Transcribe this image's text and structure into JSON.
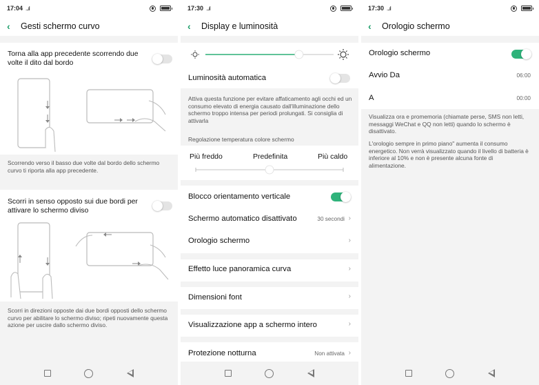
{
  "colors": {
    "accent": "#2fb37b",
    "back_arrow": "#1e9e6a",
    "background": "#f3f3f3"
  },
  "screen1": {
    "status": {
      "time": "17:04",
      "signal": "...ıl"
    },
    "header": {
      "back_icon": "chevron-left-icon",
      "title": "Gesti schermo curvo"
    },
    "gesture1": {
      "label": "Torna alla app precedente scorrendo due volte il dito dal bordo",
      "enabled": false,
      "description": "Scorrendo verso il basso due volte dal bordo dello schermo curvo ti riporta alla app precedente."
    },
    "gesture2": {
      "label": "Scorri in senso opposto sui due bordi per attivare lo schermo diviso",
      "enabled": false,
      "description": "Scorri in direzioni opposte dai due bordi opposti dello schermo curvo per abilitare lo schermo diviso; ripeti nuovamente questa azione per uscire dallo schermo diviso."
    }
  },
  "screen2": {
    "status": {
      "time": "17:30",
      "signal": "...ıl"
    },
    "header": {
      "back_icon": "chevron-left-icon",
      "title": "Display e luminosità"
    },
    "brightness": {
      "level": 0.73,
      "low_icon": "sun-small-icon",
      "high_icon": "sun-large-icon"
    },
    "auto_brightness": {
      "label": "Luminosità automatica",
      "enabled": false,
      "description": "Attiva questa funzione per evitare affaticamento agli occhi ed un consumo elevato di energia causato dall'illuminazione dello schermo troppo intensa per periodi prolungati. Si consiglia di attivarla"
    },
    "color_temp": {
      "section_label": "Regolazione temperatura colore schermo",
      "cold": "Più freddo",
      "default": "Predefinita",
      "warm": "Più caldo",
      "level": 0.5
    },
    "rows": [
      {
        "label": "Blocco orientamento verticale",
        "toggle": true
      },
      {
        "label": "Schermo automatico disattivato",
        "value": "30 secondi"
      },
      {
        "label": "Orologio schermo",
        "value": ""
      },
      {
        "label": "Effetto luce panoramica curva",
        "value": ""
      },
      {
        "label": "Dimensioni font",
        "value": ""
      },
      {
        "label": "Visualizzazione app a schermo intero",
        "value": ""
      },
      {
        "label": "Protezione notturna",
        "value": "Non attivata"
      }
    ]
  },
  "screen3": {
    "status": {
      "time": "17:30",
      "signal": "...ıl"
    },
    "header": {
      "back_icon": "chevron-left-icon",
      "title": "Orologio schermo"
    },
    "clock_toggle": {
      "label": "Orologio schermo",
      "enabled": true
    },
    "from": {
      "label": "Avvio Da",
      "value": "06:00"
    },
    "to": {
      "label": "A",
      "value": "00:00"
    },
    "description1": "Visualizza ora e promemoria (chiamate perse, SMS non letti, messaggi WeChat e QQ non letti) quando lo schermo è disattivato.",
    "description2": "L'orologio sempre in primo piano\" aumenta il consumo energetico. Non verrà visualizzato quando il livello di batteria è inferiore al 10% e non è presente alcuna fonte di alimentazione."
  },
  "navbar": {
    "recent_icon": "square-icon",
    "home_icon": "circle-icon",
    "back_icon": "triangle-back-icon"
  }
}
